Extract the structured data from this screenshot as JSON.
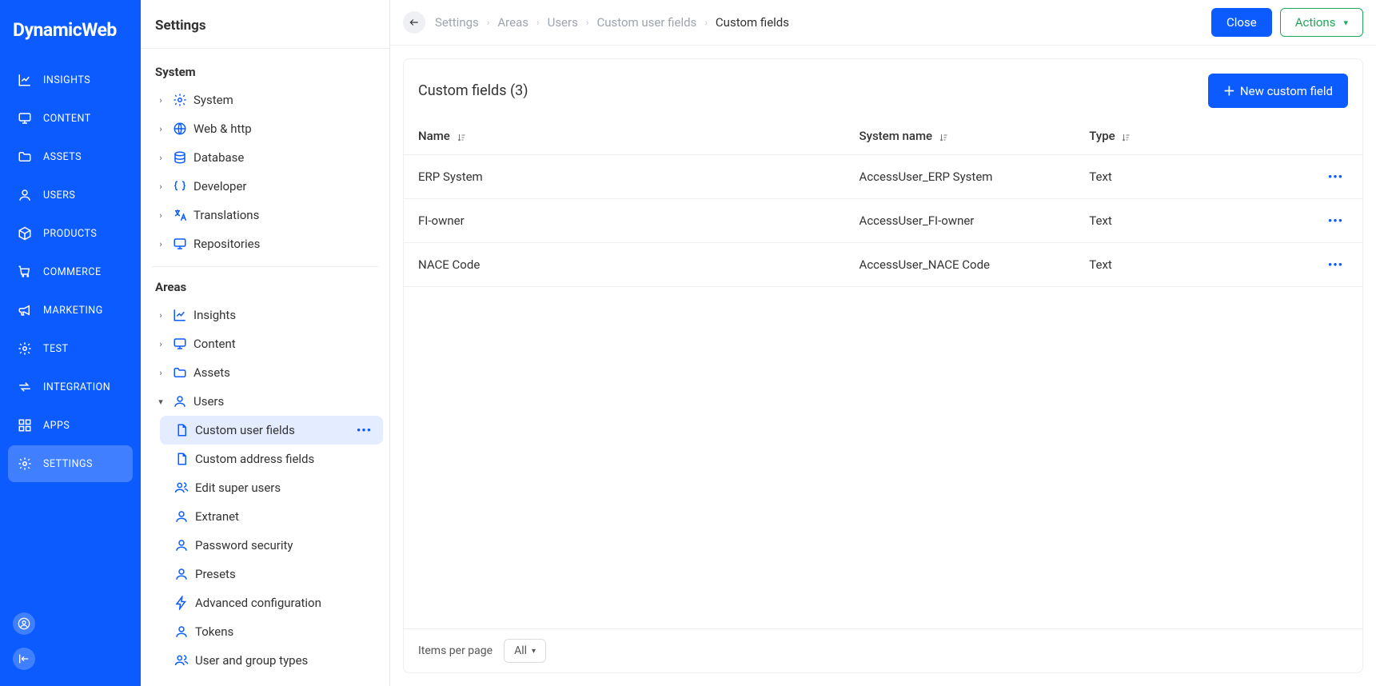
{
  "brand": "DynamicWeb",
  "primaryNav": [
    {
      "label": "INSIGHTS",
      "icon": "chart"
    },
    {
      "label": "CONTENT",
      "icon": "monitor"
    },
    {
      "label": "ASSETS",
      "icon": "folder"
    },
    {
      "label": "USERS",
      "icon": "user"
    },
    {
      "label": "PRODUCTS",
      "icon": "box"
    },
    {
      "label": "COMMERCE",
      "icon": "cart"
    },
    {
      "label": "MARKETING",
      "icon": "megaphone"
    },
    {
      "label": "TEST",
      "icon": "gear"
    },
    {
      "label": "INTEGRATION",
      "icon": "swap"
    },
    {
      "label": "APPS",
      "icon": "grid"
    },
    {
      "label": "SETTINGS",
      "icon": "gear",
      "active": true
    }
  ],
  "sidebar": {
    "title": "Settings",
    "sections": {
      "system": {
        "title": "System",
        "items": [
          {
            "label": "System",
            "icon": "gear"
          },
          {
            "label": "Web & http",
            "icon": "globe"
          },
          {
            "label": "Database",
            "icon": "db"
          },
          {
            "label": "Developer",
            "icon": "braces"
          },
          {
            "label": "Translations",
            "icon": "translate"
          },
          {
            "label": "Repositories",
            "icon": "monitor"
          }
        ]
      },
      "areas": {
        "title": "Areas",
        "items": [
          {
            "label": "Insights",
            "icon": "chart"
          },
          {
            "label": "Content",
            "icon": "monitor"
          },
          {
            "label": "Assets",
            "icon": "folder"
          },
          {
            "label": "Users",
            "icon": "user",
            "expanded": true,
            "children": [
              {
                "label": "Custom user fields",
                "icon": "doc",
                "active": true
              },
              {
                "label": "Custom address fields",
                "icon": "doc"
              },
              {
                "label": "Edit super users",
                "icon": "users"
              },
              {
                "label": "Extranet",
                "icon": "user"
              },
              {
                "label": "Password security",
                "icon": "user"
              },
              {
                "label": "Presets",
                "icon": "user"
              },
              {
                "label": "Advanced configuration",
                "icon": "bolt"
              },
              {
                "label": "Tokens",
                "icon": "user"
              },
              {
                "label": "User and group types",
                "icon": "users"
              }
            ]
          }
        ]
      }
    }
  },
  "breadcrumbs": [
    "Settings",
    "Areas",
    "Users",
    "Custom user fields",
    "Custom fields"
  ],
  "topbar": {
    "close": "Close",
    "actions": "Actions"
  },
  "panel": {
    "title": "Custom fields (3)",
    "newButton": "New custom field",
    "columns": {
      "name": "Name",
      "system": "System name",
      "type": "Type"
    },
    "rows": [
      {
        "name": "ERP System",
        "system": "AccessUser_ERP System",
        "type": "Text"
      },
      {
        "name": "FI-owner",
        "system": "AccessUser_FI-owner",
        "type": "Text"
      },
      {
        "name": "NACE Code",
        "system": "AccessUser_NACE Code",
        "type": "Text"
      }
    ],
    "footer": {
      "label": "Items per page",
      "value": "All"
    }
  }
}
